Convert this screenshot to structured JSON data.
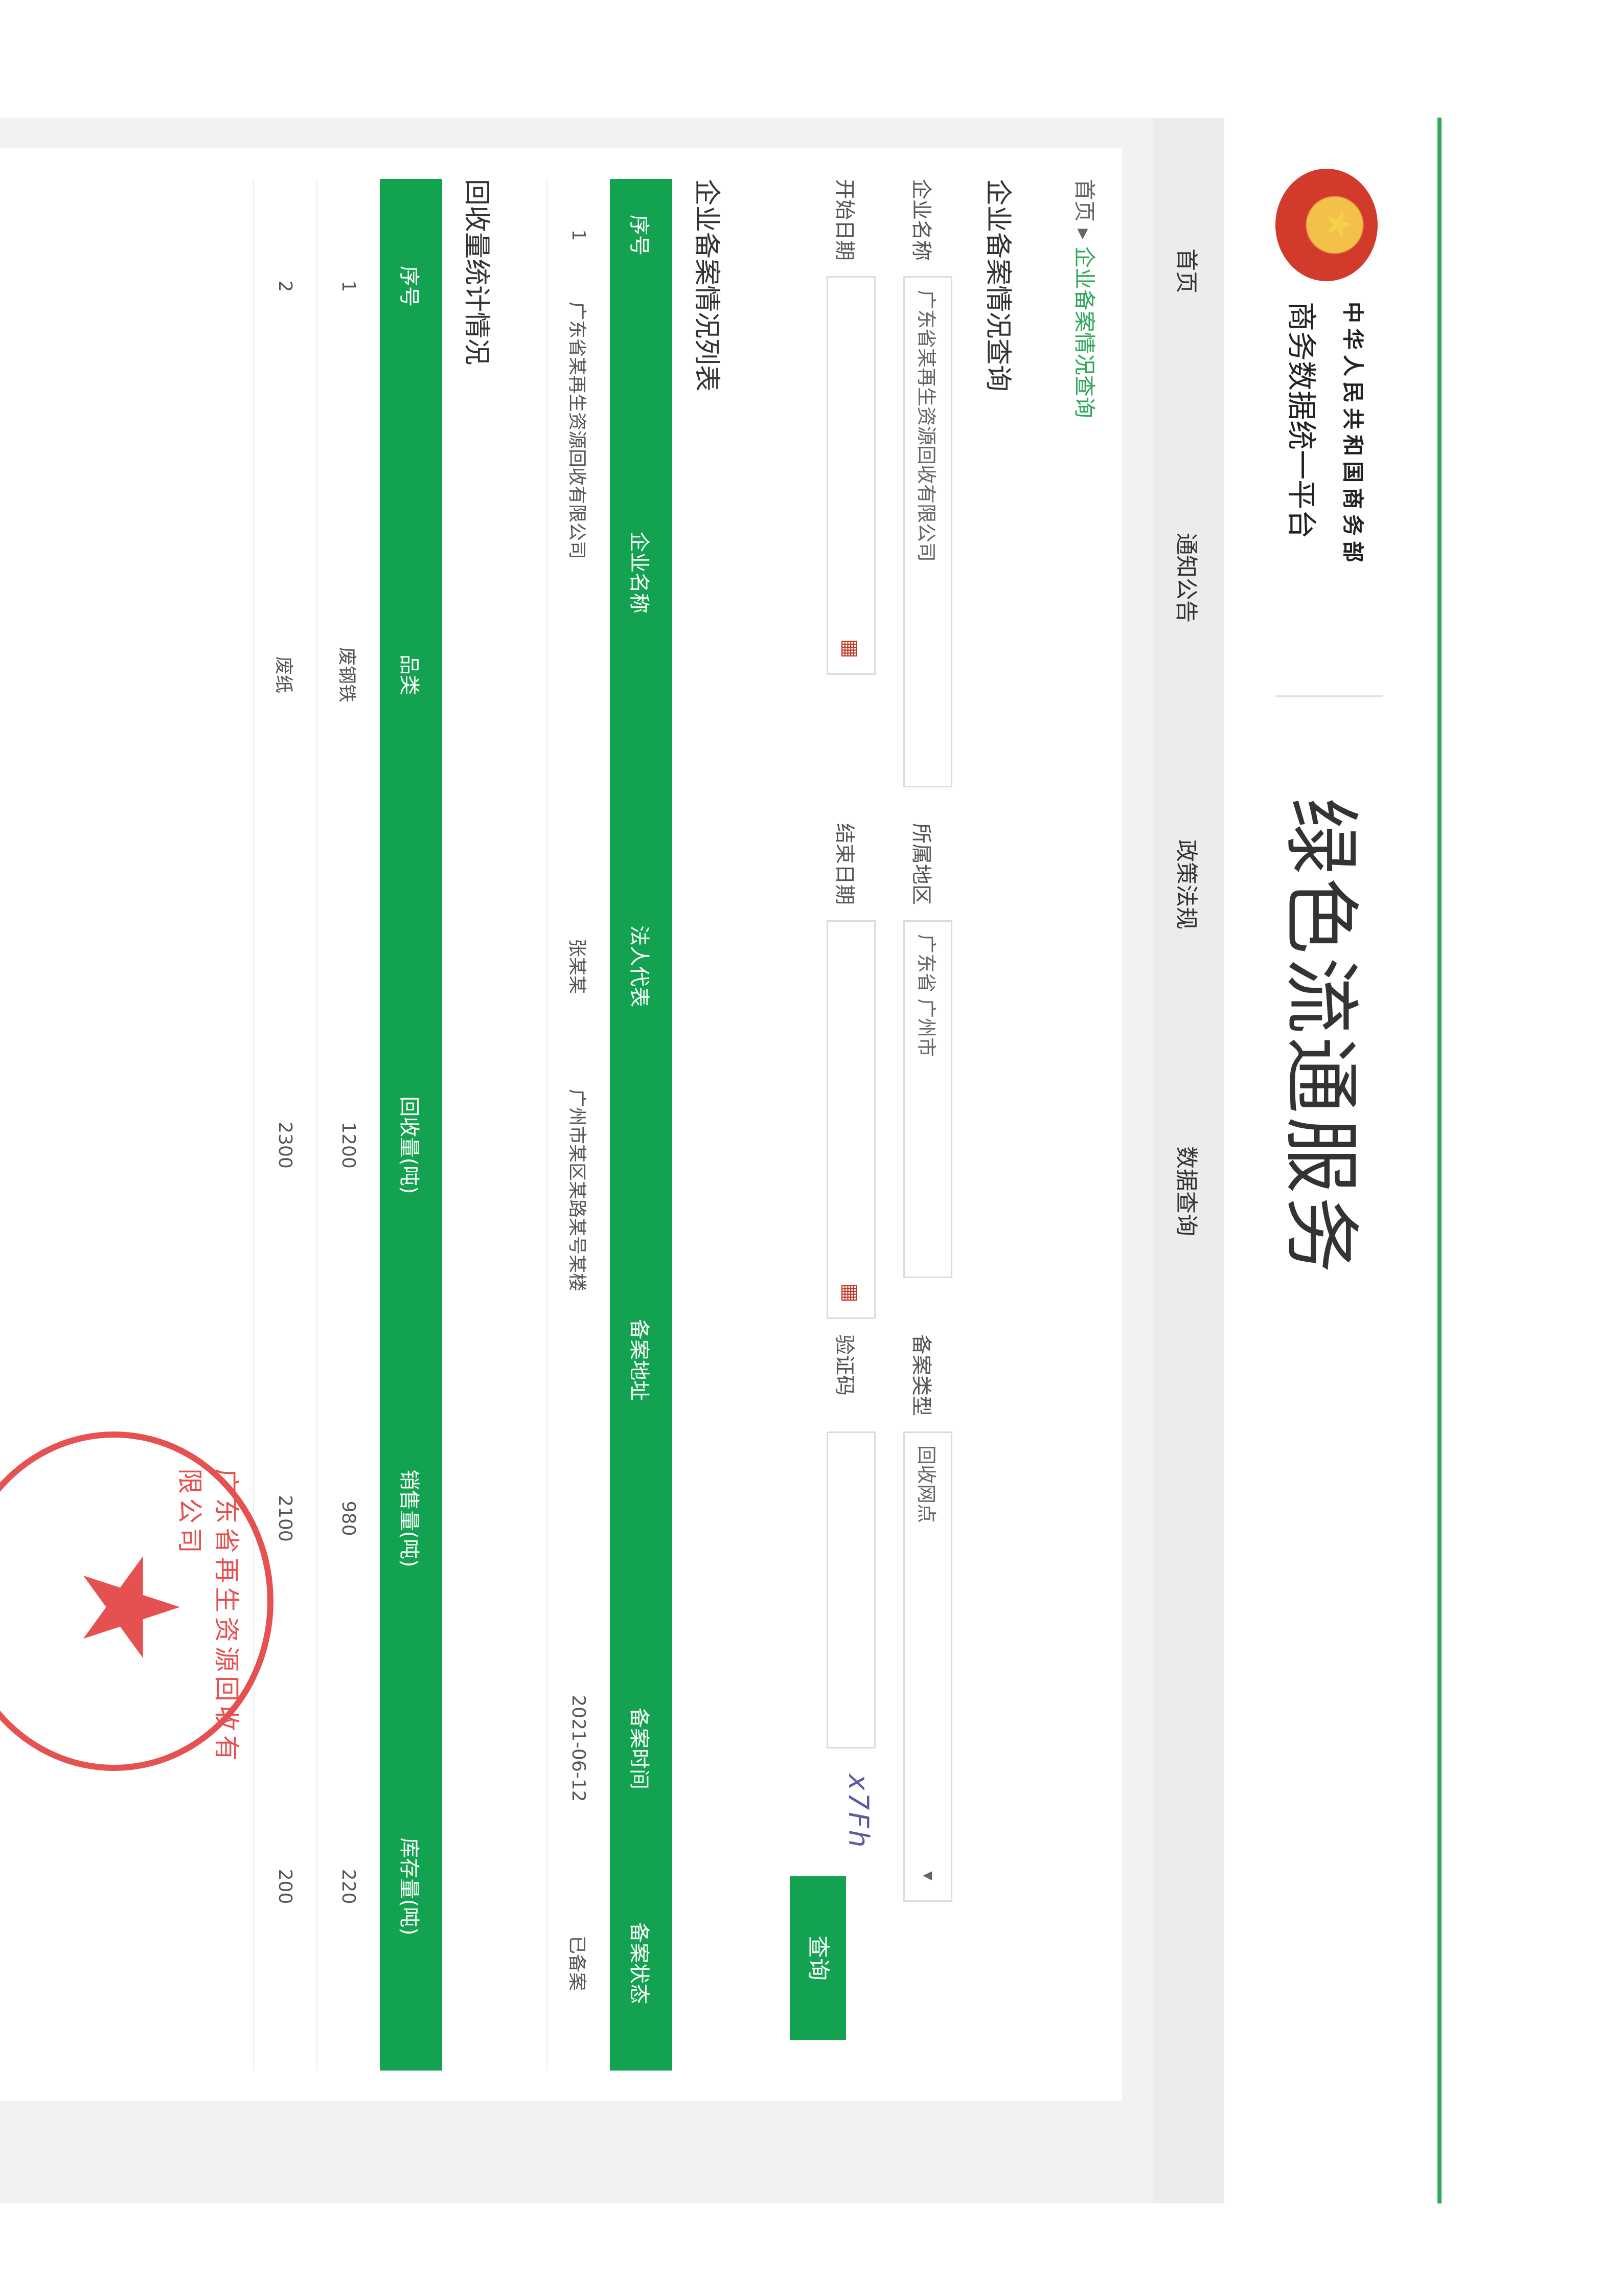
{
  "header": {
    "logo_line1": "中华人民共和国商务部",
    "logo_line2": "商务数据统一平台",
    "site_title": "绿色流通服务"
  },
  "nav": {
    "items": [
      "首页",
      "通知公告",
      "政策法规",
      "数据查询"
    ]
  },
  "breadcrumb": {
    "home": "首页",
    "sep": "▸",
    "current": "企业备案情况查询"
  },
  "query": {
    "title": "企业备案情况查询",
    "company_label": "企业名称",
    "company_value": "广东省某再生资源回收有限公司",
    "region_label": "所属地区",
    "region_value": "广东省 广州市",
    "type_label": "备案类型",
    "type_value": "回收网点",
    "start_label": "开始日期",
    "end_label": "结束日期",
    "code_label": "验证码",
    "captcha": "x7Fh",
    "query_button": "查询"
  },
  "result": {
    "title": "企业备案情况列表",
    "headers": [
      "序号",
      "企业名称",
      "法人代表",
      "备案地址",
      "备案时间",
      "备案状态"
    ],
    "rows": [
      [
        "1",
        "广东省某再生资源回收有限公司",
        "张某某",
        "广州市某区某路某号某楼",
        "2021-06-12",
        "已备案"
      ]
    ]
  },
  "stats": {
    "title": "回收量统计情况",
    "headers": [
      "序号",
      "品类",
      "回收量(吨)",
      "销售量(吨)",
      "库存量(吨)"
    ],
    "rows": [
      [
        "1",
        "废钢铁",
        "1200",
        "980",
        "220"
      ],
      [
        "2",
        "废纸",
        "2300",
        "2100",
        "200"
      ]
    ]
  },
  "seal": {
    "text": "广东省再生资源回收有限公司"
  },
  "colors": {
    "brand_green": "#13a24f",
    "rule_green": "#2fa85a",
    "seal_red": "#e23a3a"
  }
}
